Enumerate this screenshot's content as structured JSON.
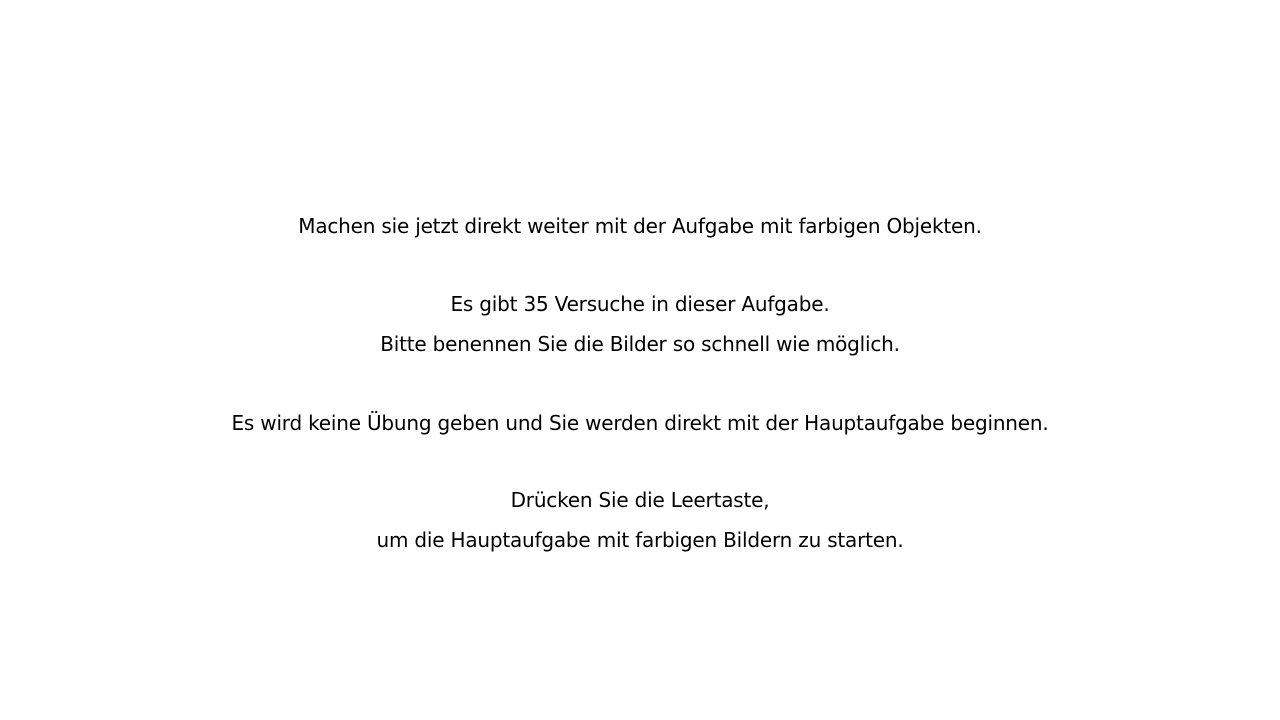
{
  "instructions": {
    "line1": "Machen sie jetzt direkt weiter mit der Aufgabe mit farbigen Objekten.",
    "line2": "Es gibt 35 Versuche in dieser Aufgabe.",
    "line3": "Bitte benennen Sie die Bilder so schnell wie möglich.",
    "line4": "Es wird keine Übung geben und Sie werden direkt mit der Hauptaufgabe beginnen.",
    "line5": "Drücken Sie die Leertaste,",
    "line6": "um die Hauptaufgabe mit farbigen Bildern zu starten."
  },
  "colors": {
    "background": "#ffffff",
    "text": "#000000"
  }
}
